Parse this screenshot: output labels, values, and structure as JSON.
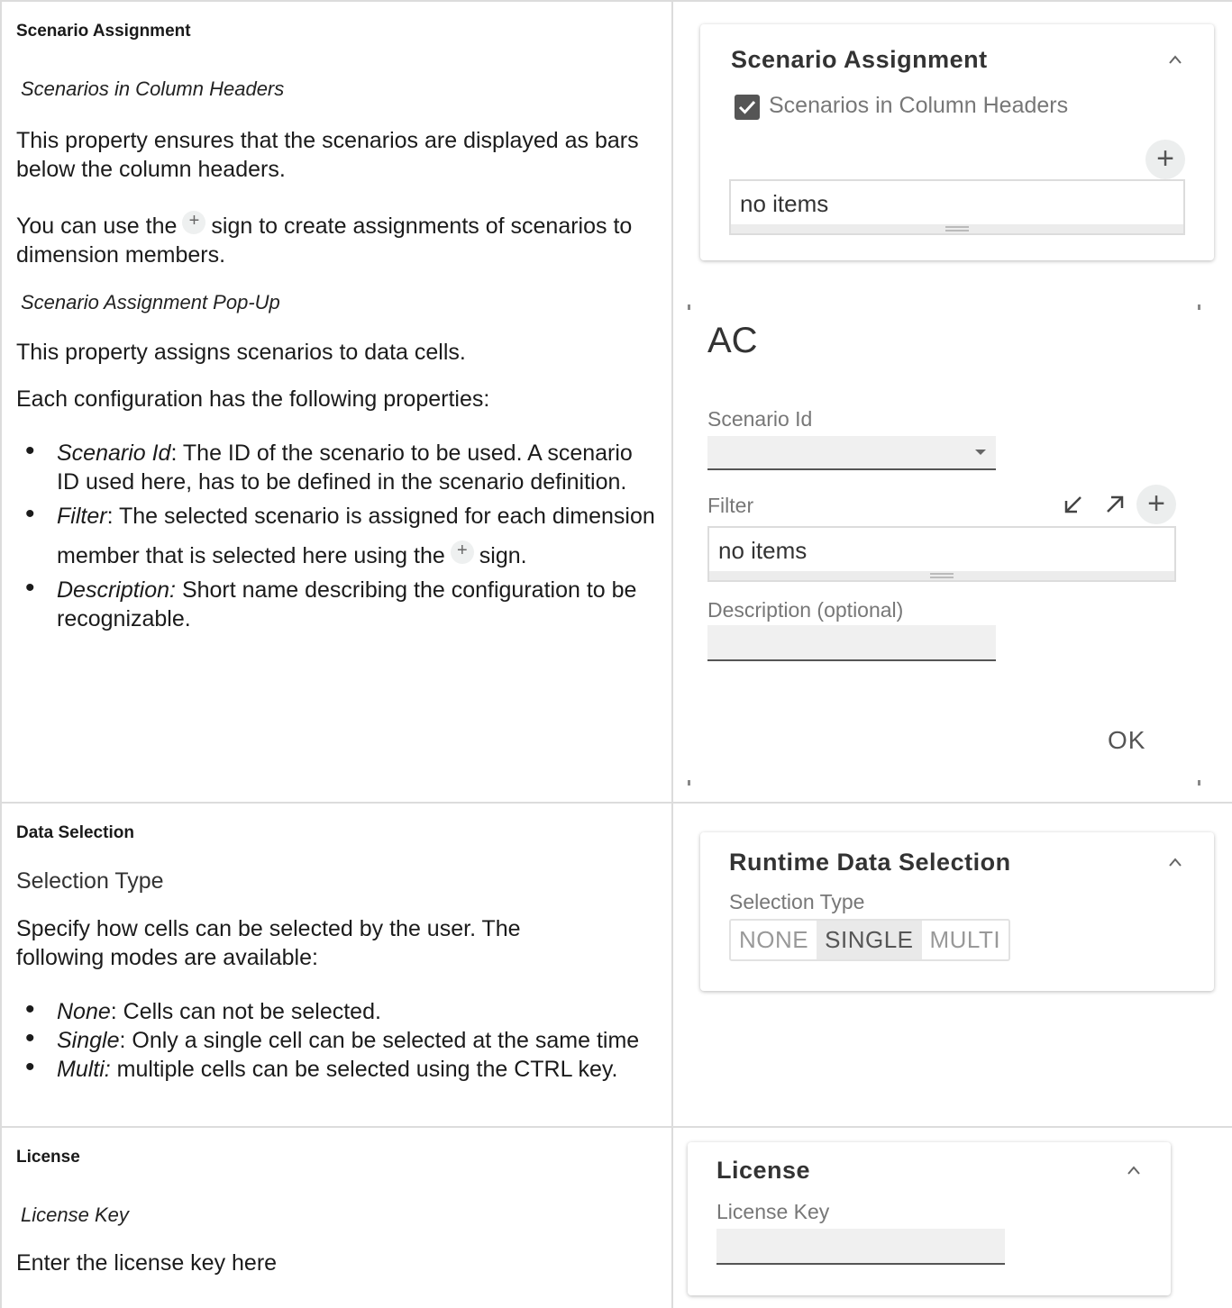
{
  "rows": {
    "scenario": {
      "section_title": "Scenario Assignment",
      "sub1_title": "Scenarios in Column Headers",
      "sub1_para1": "This property ensures that the scenarios are displayed as bars below the column headers.",
      "sub1_para2_a": "You can use the",
      "sub1_para2_b": "sign to create assignments of scenarios to dimension members.",
      "sub2_title": "Scenario Assignment Pop-Up",
      "sub2_para1": "This property assigns scenarios to data cells.",
      "sub2_para2": "Each configuration has the following properties:",
      "bullets": [
        {
          "term": "Scenario Id",
          "text": ": The ID of the scenario to be used. A scenario ID used here, has to be defined in the scenario definition."
        },
        {
          "term": "Filter",
          "text": ": The selected scenario is assigned for each dimension member that is selected here using the",
          "text_after": "sign."
        },
        {
          "term": "Description:",
          "text": " Short name describing the configuration to be recognizable."
        }
      ],
      "panel": {
        "title": "Scenario Assignment",
        "checkbox_label": "Scenarios in Column Headers",
        "list_text": "no items"
      },
      "popup": {
        "title": "AC",
        "scenario_id_label": "Scenario Id",
        "filter_label": "Filter",
        "filter_list_text": "no items",
        "description_label": "Description (optional)",
        "ok_label": "OK"
      }
    },
    "data_selection": {
      "section_title": "Data Selection",
      "sub_title": "Selection Type",
      "para": "Specify how cells can be selected by the user. The following modes are available:",
      "bullets": [
        {
          "term": "None",
          "text": ": Cells can not be selected."
        },
        {
          "term": "Single",
          "text": ": Only a single cell can be selected at the same time"
        },
        {
          "term": "Multi:",
          "text": " multiple cells can be selected using the CTRL key."
        }
      ],
      "panel": {
        "title": "Runtime Data Selection",
        "label": "Selection Type",
        "options": [
          "NONE",
          "SINGLE",
          "MULTI"
        ],
        "selected": "SINGLE"
      }
    },
    "license": {
      "section_title": "License",
      "sub_title": "License Key",
      "para": "Enter the license key here",
      "panel": {
        "title": "License",
        "label": "License Key"
      }
    }
  }
}
